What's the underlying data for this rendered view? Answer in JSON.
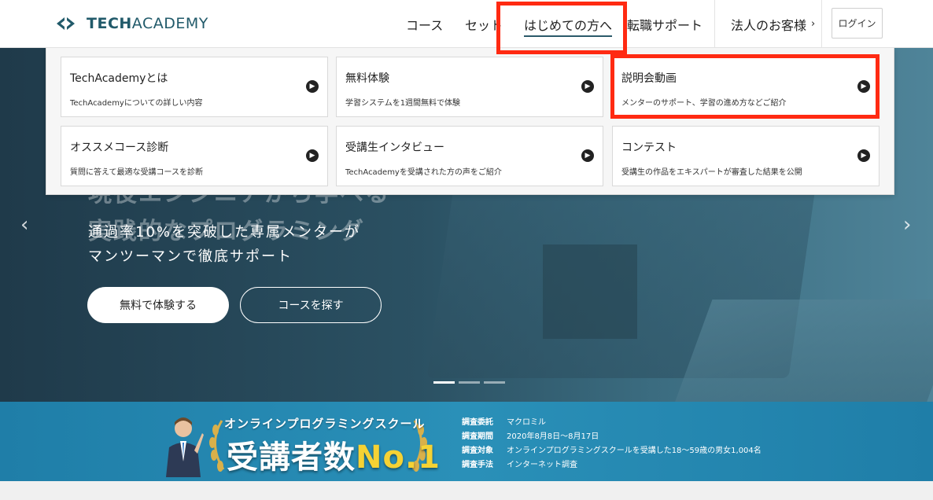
{
  "brand": {
    "logo_bold": "TECH",
    "logo_light": "ACADEMY",
    "color": "#215a6a"
  },
  "nav": {
    "items": [
      {
        "label": "コース"
      },
      {
        "label": "セット"
      },
      {
        "label": "はじめての方へ"
      },
      {
        "label": "転職サポート"
      },
      {
        "label": "法人のお客様"
      }
    ],
    "corporate_chevron": "›",
    "login_label": "ログイン"
  },
  "dropdown": {
    "cards": [
      {
        "title": "TechAcademyとは",
        "desc": "TechAcademyについての詳しい内容"
      },
      {
        "title": "無料体験",
        "desc": "学習システムを1週間無料で体験"
      },
      {
        "title": "説明会動画",
        "desc": "メンターのサポート、学習の進め方などご紹介"
      },
      {
        "title": "オススメコース診断",
        "desc": "質問に答えて最適な受講コースを診断"
      },
      {
        "title": "受講生インタビュー",
        "desc": "TechAcademyを受講された方の声をご紹介"
      },
      {
        "title": "コンテスト",
        "desc": "受講生の作品をエキスパートが審査した結果を公開"
      }
    ]
  },
  "hero": {
    "title_line1": "現役エンジニアから学べる",
    "title_line2": "実践的なプログラミング",
    "sub_line1": "通過率10%を突破した専属メンターが",
    "sub_line2": "マンツーマンで徹底サポート",
    "btn_free": "無料で体験する",
    "btn_course": "コースを探す",
    "prev": "‹",
    "next": "›"
  },
  "banner": {
    "top": "オンラインプログラミングスクール",
    "main": "受講者数",
    "no1": "No.1",
    "info": [
      {
        "key": "調査委託",
        "value": "マクロミル"
      },
      {
        "key": "調査期間",
        "value": "2020年8月8日〜8月17日"
      },
      {
        "key": "調査対象",
        "value": "オンラインプログラミングスクールを受講した18〜59歳の男女1,004名"
      },
      {
        "key": "調査手法",
        "value": "インターネット調査"
      }
    ]
  },
  "colors": {
    "highlight": "#ff2a12",
    "banner": "#2a90b8",
    "gold": "#f5d234"
  }
}
